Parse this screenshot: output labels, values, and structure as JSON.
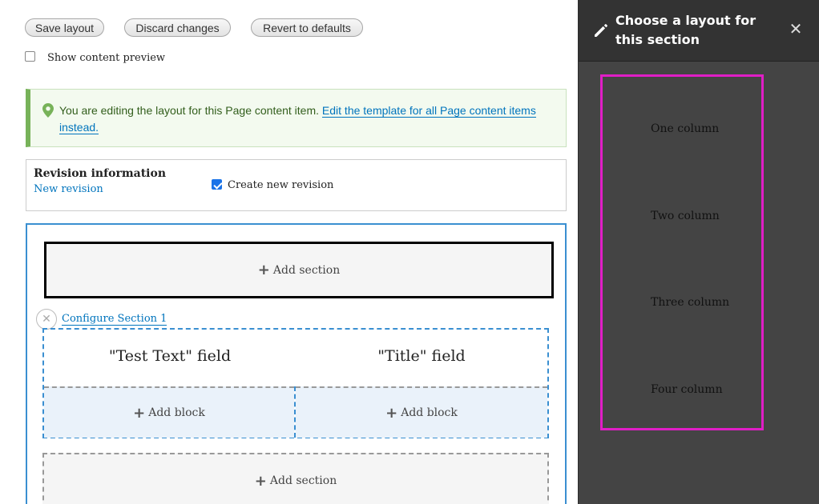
{
  "toolbar": {
    "save_label": "Save layout",
    "discard_label": "Discard changes",
    "revert_label": "Revert to defaults"
  },
  "preview": {
    "label": "Show content preview",
    "checked": false
  },
  "message": {
    "text": "You are editing the layout for this Page content item.",
    "link_text": "Edit the template for all Page content items instead."
  },
  "revision": {
    "title": "Revision information",
    "summary": "New revision",
    "create_label": "Create new revision",
    "create_checked": true
  },
  "builder": {
    "add_section_label": "Add section",
    "configure_label": "Configure Section 1",
    "columns": [
      {
        "field_label": "\"Test Text\" field",
        "add_block_label": "Add block"
      },
      {
        "field_label": "\"Title\" field",
        "add_block_label": "Add block"
      }
    ]
  },
  "sidebar": {
    "title": "Choose a layout for this section",
    "layouts": [
      "One column",
      "Two column",
      "Three column",
      "Four column"
    ]
  },
  "colors": {
    "accent": "#3a8fd1",
    "status_green": "#77b259",
    "highlight": "#e01ec6",
    "sidebar_bg": "#444444"
  }
}
